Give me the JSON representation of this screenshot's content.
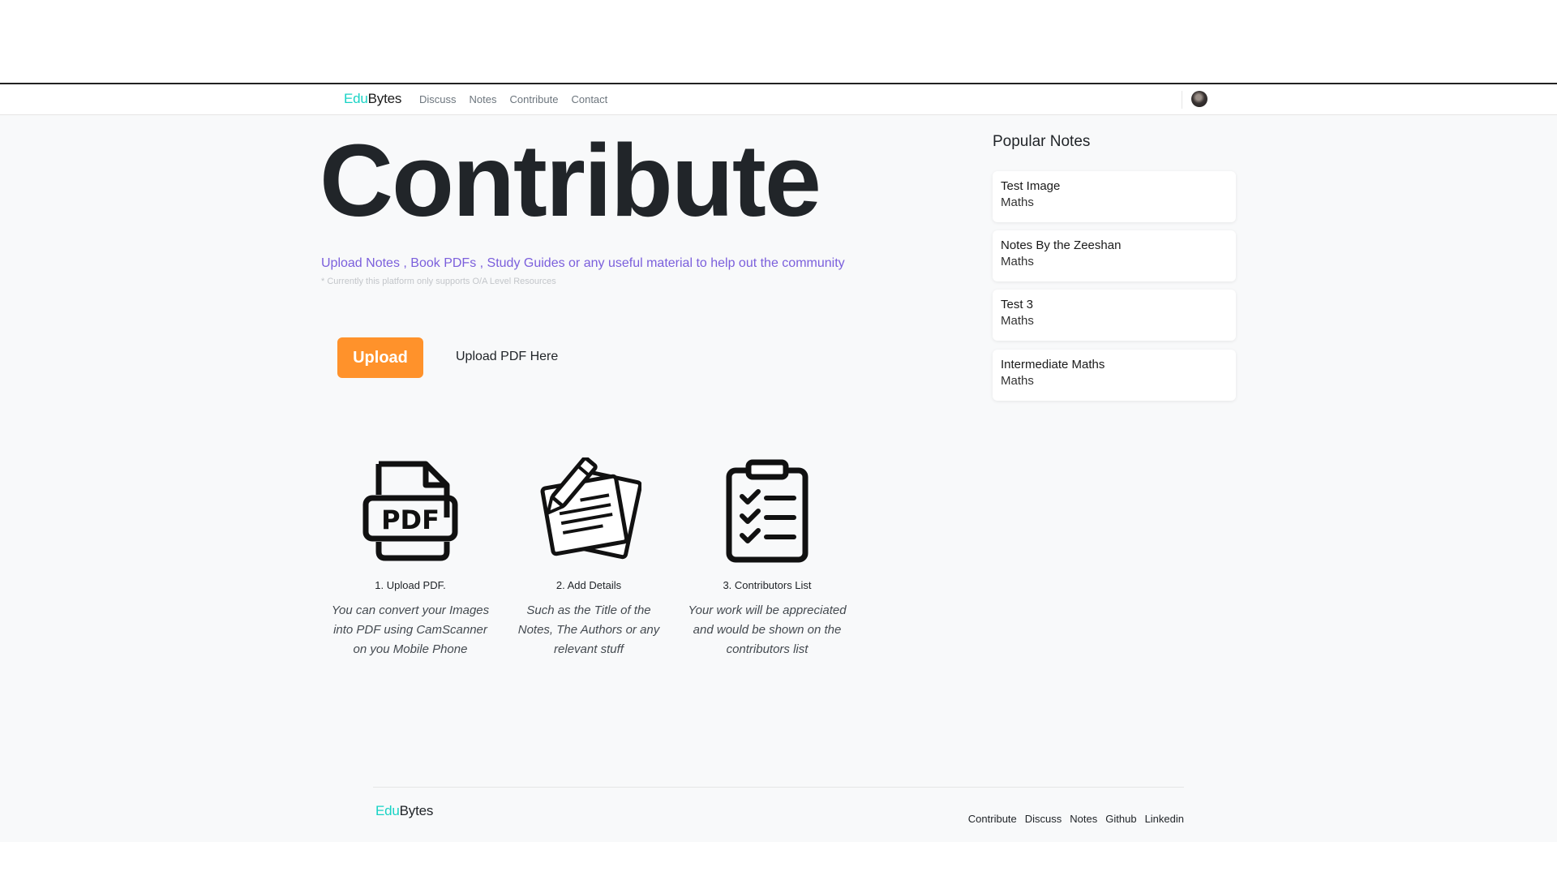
{
  "nav": {
    "brand_edu": "Edu",
    "brand_bytes": "Bytes",
    "links": [
      "Discuss",
      "Notes",
      "Contribute",
      "Contact"
    ]
  },
  "hero": {
    "title": "Contribute",
    "subtitle": "Upload Notes , Book PDFs , Study Guides or any useful material to help out the community",
    "note": "* Currently this platform only supports O/A Level Resources"
  },
  "upload": {
    "button_label": "Upload",
    "label": "Upload PDF Here"
  },
  "steps": [
    {
      "icon": "pdf-file-icon",
      "title": "1. Upload PDF.",
      "desc": "You can convert your Images into PDF using CamScanner on you Mobile Phone"
    },
    {
      "icon": "pencil-paper-icon",
      "title": "2. Add Details",
      "desc": "Such as the Title of the Notes, The Authors or any relevant stuff"
    },
    {
      "icon": "checklist-clipboard-icon",
      "title": "3. Contributors List",
      "desc": "Your work will be appreciated and would be shown on the contributors list"
    }
  ],
  "sidebar": {
    "title": "Popular Notes",
    "notes": [
      {
        "title": "Test Image",
        "subject": "Maths"
      },
      {
        "title": "Notes By the Zeeshan",
        "subject": "Maths"
      },
      {
        "title": "Test 3",
        "subject": "Maths"
      },
      {
        "title": "Intermediate Maths",
        "subject": "Maths"
      }
    ]
  },
  "footer": {
    "brand_edu": "Edu",
    "brand_bytes": "Bytes",
    "links": [
      "Contribute",
      "Discuss",
      "Notes",
      "Github",
      "Linkedin"
    ]
  },
  "colors": {
    "brand_accent": "#19d3c5",
    "upload_button": "#ff922b",
    "subtitle": "#7b5fdc",
    "page_background": "#f8f9fa"
  }
}
